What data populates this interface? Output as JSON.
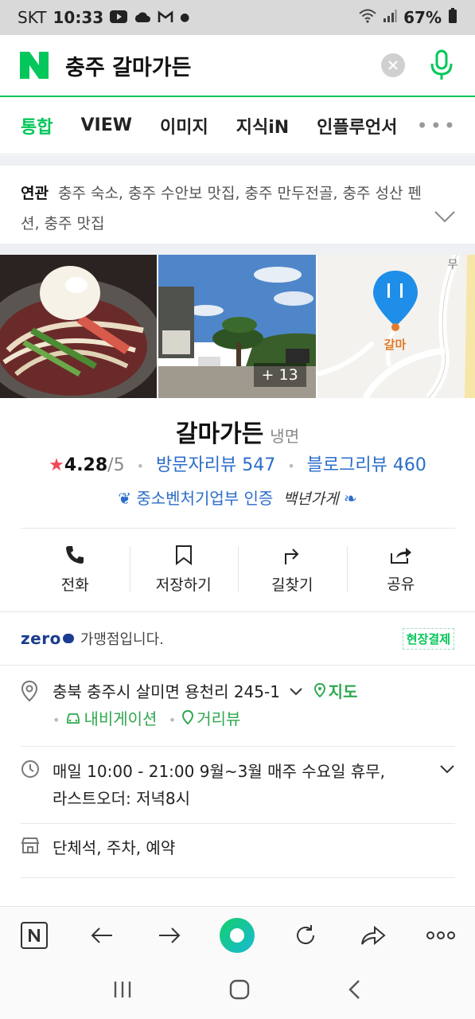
{
  "status_bar": {
    "carrier": "SKT",
    "time": "10:33",
    "battery": "67%"
  },
  "search": {
    "query": "충주 갈마가든"
  },
  "tabs": [
    {
      "label": "통합",
      "active": true
    },
    {
      "label": "VIEW"
    },
    {
      "label": "이미지"
    },
    {
      "label": "지식iN"
    },
    {
      "label": "인플루언서"
    }
  ],
  "tabs_more": "•••",
  "related": {
    "label": "연관",
    "text": "충주 숙소, 충주 수안보 맛집, 충주 만두전골, 충주 성산 펜션, 충주 맛집"
  },
  "photos": {
    "more_count": "+ 13",
    "map_marker_label": "갈마",
    "map_road_label": "무"
  },
  "place": {
    "name": "갈마가든",
    "category": "냉면",
    "rating": "4.28",
    "rating_max": "/5",
    "visitor_reviews": "방문자리뷰 547",
    "blog_reviews": "블로그리뷰 460",
    "certification": "중소벤처기업부 인증",
    "certification_script": "백년가게"
  },
  "actions": [
    {
      "label": "전화",
      "icon": "phone-icon"
    },
    {
      "label": "저장하기",
      "icon": "bookmark-icon"
    },
    {
      "label": "길찾기",
      "icon": "directions-icon"
    },
    {
      "label": "공유",
      "icon": "share-icon"
    }
  ],
  "zeropay": {
    "logo": "zero",
    "text": "가맹점입니다.",
    "badge": "현장결제"
  },
  "address": {
    "text": "충북 충주시 살미면 용천리 245-1",
    "map_link": "지도",
    "navi_link": "내비게이션",
    "street_link": "거리뷰"
  },
  "hours": {
    "line1": "매일 10:00 - 21:00 9월~3월 매주 수요일 휴무,",
    "line2": "라스트오더: 저녁8시"
  },
  "amenities": {
    "text": "단체석, 주차, 예약"
  },
  "colors": {
    "brand_green": "#03c75a",
    "link_blue": "#2b6dc9",
    "star_red": "#f04a55"
  }
}
